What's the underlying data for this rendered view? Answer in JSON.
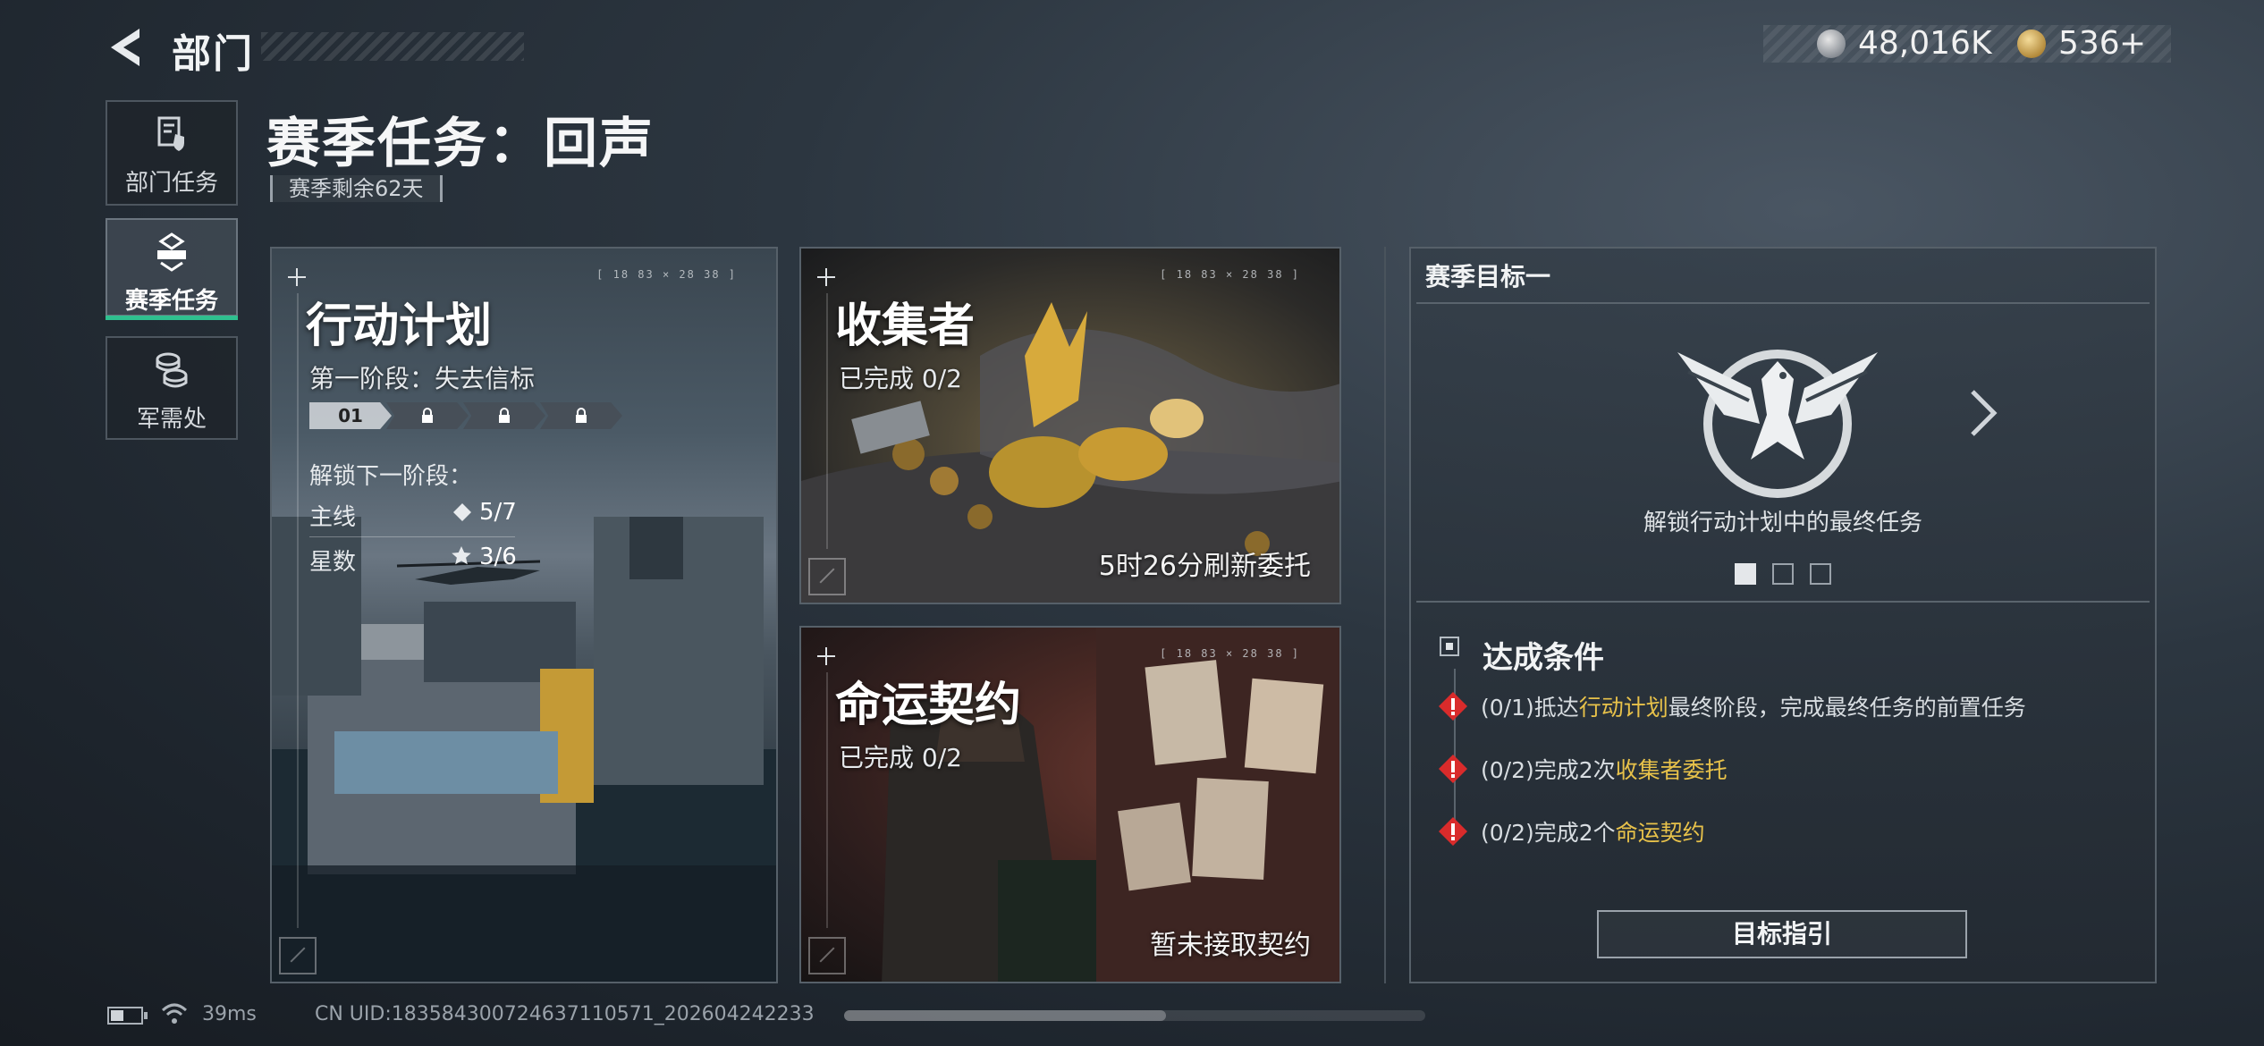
{
  "header": {
    "title": "部门",
    "back_icon": "back-arrow-icon"
  },
  "currency": {
    "silver_value": "48,016K",
    "gold_value": "536",
    "add_icon": "+"
  },
  "sidebar": {
    "items": [
      {
        "label": "部门任务",
        "icon": "document-shield-icon"
      },
      {
        "label": "赛季任务",
        "icon": "season-badge-icon",
        "active": true
      },
      {
        "label": "军需处",
        "icon": "coin-stack-icon"
      }
    ]
  },
  "page": {
    "title": "赛季任务：回声",
    "remaining": "赛季剩余62天"
  },
  "cards": {
    "ops": {
      "title": "行动计划",
      "coord": "[ 18 83 × 28 38 ]",
      "stage_label": "第一阶段：失去信标",
      "stages": [
        "01",
        "",
        "",
        ""
      ],
      "unlock_label": "解锁下一阶段：",
      "main_label": "主线",
      "main_value": "5/7",
      "star_label": "星数",
      "star_value": "3/6"
    },
    "collector": {
      "title": "收集者",
      "coord": "[ 18 83 × 28 38 ]",
      "progress": "已完成 0/2",
      "refresh": "5时26分刷新委托"
    },
    "fate": {
      "title": "命运契约",
      "coord": "[ 18 83 × 28 38 ]",
      "progress": "已完成 0/2",
      "status": "暂未接取契约"
    }
  },
  "goal": {
    "title": "赛季目标一",
    "description": "解锁行动计划中的最终任务",
    "pager_count": 3,
    "pager_active": 0,
    "conditions_title": "达成条件",
    "conditions": [
      {
        "prefix": "(0/1)抵达",
        "highlight": "行动计划",
        "suffix": "最终阶段，完成最终任务的前置任务"
      },
      {
        "prefix": "(0/2)完成2次",
        "highlight": "收集者委托",
        "suffix": ""
      },
      {
        "prefix": "(0/2)完成2个",
        "highlight": "命运契约",
        "suffix": ""
      }
    ],
    "button": "目标指引",
    "highlight_color": "#e8c24a",
    "warning_color": "#d92b2b"
  },
  "footer": {
    "ping": "39ms",
    "uid": "CN UID:1835843007246371105​71_202604242233"
  }
}
